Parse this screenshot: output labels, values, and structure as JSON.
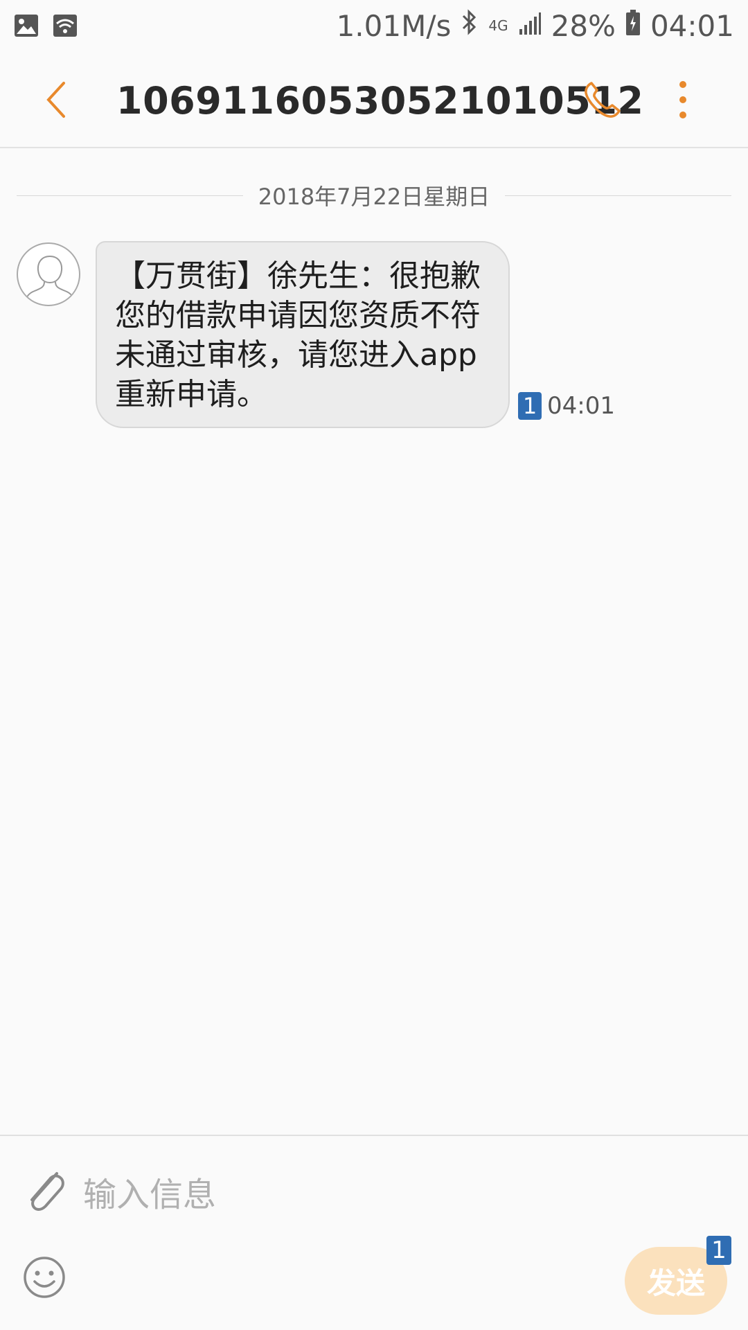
{
  "status_bar": {
    "speed": "1.01M/s",
    "network": "4G",
    "battery": "28%",
    "time": "04:01",
    "icons": [
      "image-icon",
      "wifi-icon",
      "bluetooth-icon",
      "signal-icon",
      "battery-icon"
    ]
  },
  "header": {
    "title": "1069116053052101 0512",
    "title_text": "10691160530521010512"
  },
  "conversation": {
    "date": "2018年7月22日星期日",
    "messages": [
      {
        "text": "【万贯街】徐先生：很抱歉您的借款申请因您资质不符未通过审核，请您进入app重新申请。",
        "sim": "1",
        "time": "04:01"
      }
    ]
  },
  "composer": {
    "placeholder": "输入信息",
    "send_label": "发送",
    "send_sim": "1"
  },
  "colors": {
    "accent": "#e8892c",
    "sim_badge": "#2f6db3",
    "bubble": "#ececec",
    "send_disabled": "#fbe1bd"
  }
}
